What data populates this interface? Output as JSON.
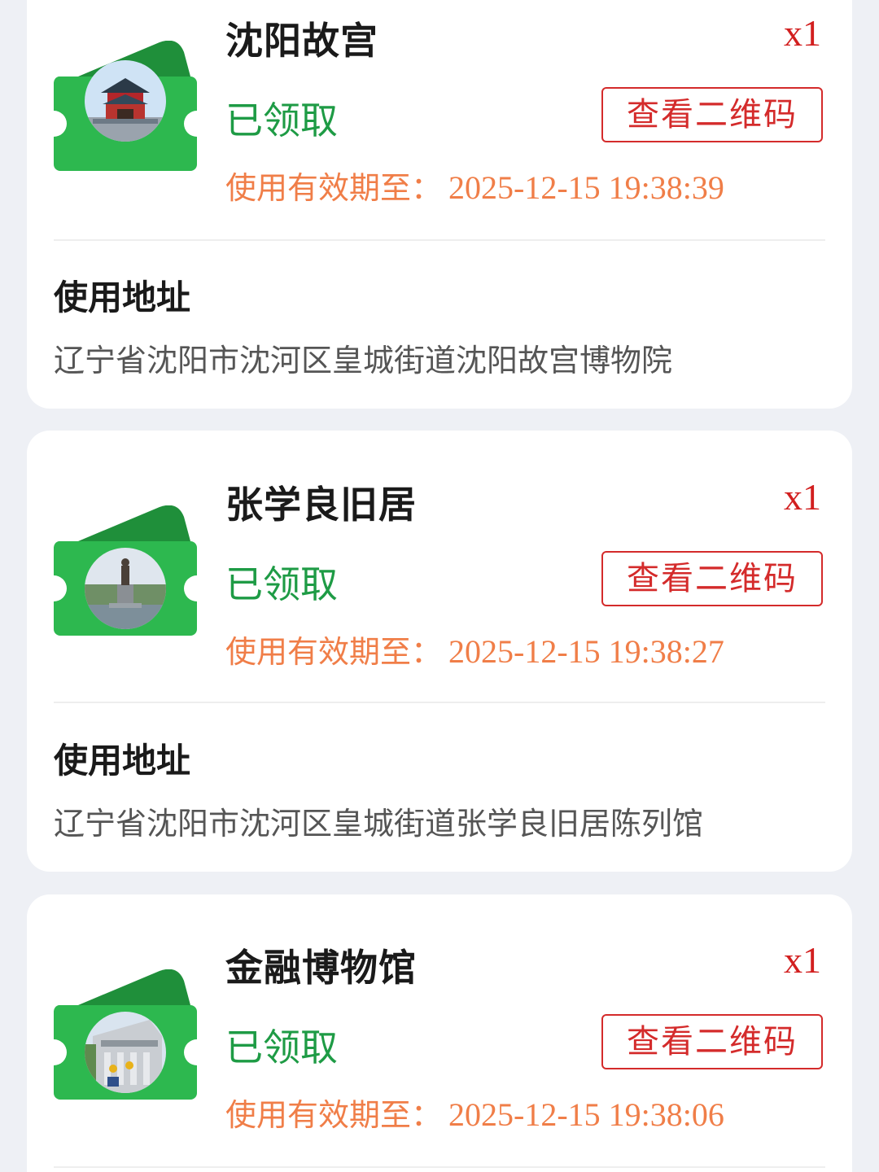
{
  "colors": {
    "page_background": "#eef0f5",
    "card_background": "#ffffff",
    "status_green": "#1e9b45",
    "button_red": "#d42b2b",
    "validity_orange": "#f07e48",
    "ticket_green": "#2db84f"
  },
  "tickets": [
    {
      "name": "沈阳故宫",
      "quantity": "x1",
      "status": "已领取",
      "qr_button_label": "查看二维码",
      "validity_label": "使用有效期至：",
      "validity_date": "2025-12-15 19:38:39",
      "address_label": "使用地址",
      "address": "辽宁省沈阳市沈河区皇城街道沈阳故宫博物院",
      "thumbnail": "palace-tower-photo"
    },
    {
      "name": "张学良旧居",
      "quantity": "x1",
      "status": "已领取",
      "qr_button_label": "查看二维码",
      "validity_label": "使用有效期至：",
      "validity_date": "2025-12-15 19:38:27",
      "address_label": "使用地址",
      "address": "辽宁省沈阳市沈河区皇城街道张学良旧居陈列馆",
      "thumbnail": "statue-photo"
    },
    {
      "name": "金融博物馆",
      "quantity": "x1",
      "status": "已领取",
      "qr_button_label": "查看二维码",
      "validity_label": "使用有效期至：",
      "validity_date": "2025-12-15 19:38:06",
      "thumbnail": "museum-building-photo"
    }
  ]
}
